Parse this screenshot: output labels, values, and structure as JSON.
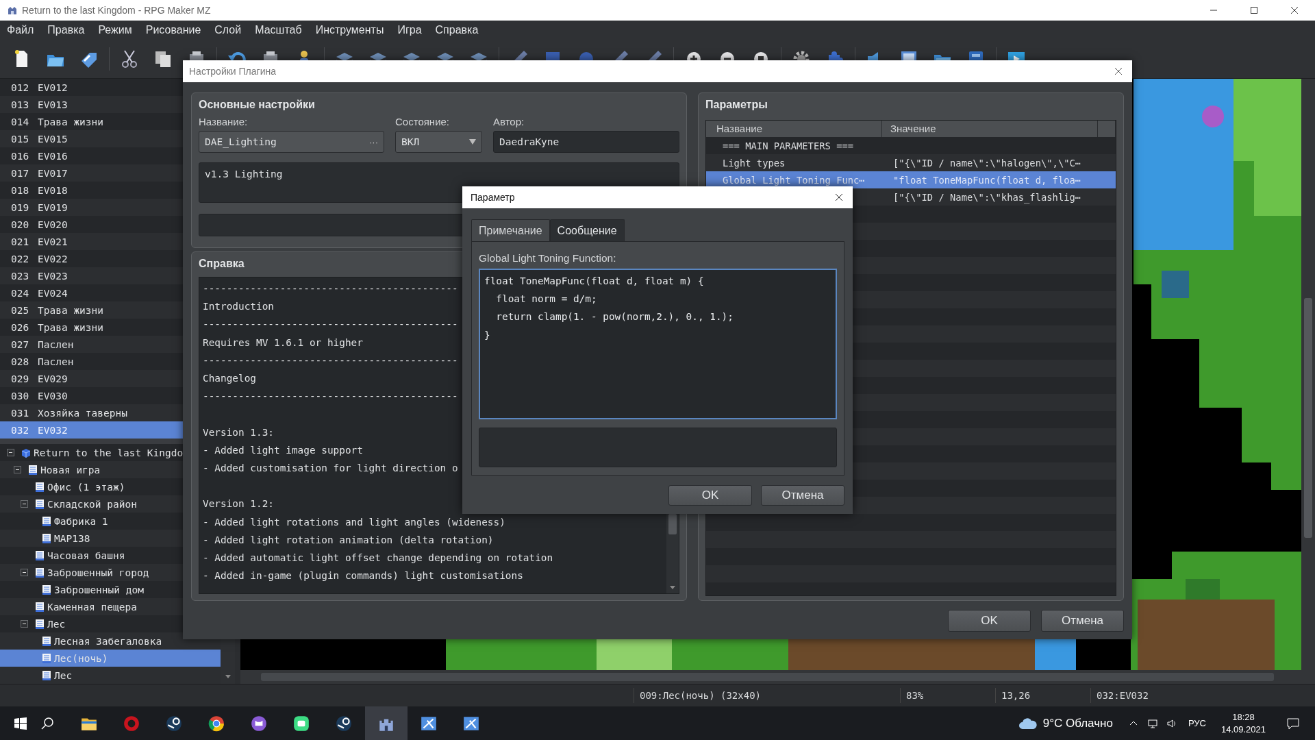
{
  "window": {
    "title": "Return to the last Kingdom - RPG Maker MZ"
  },
  "menu": [
    "Файл",
    "Правка",
    "Режим",
    "Рисование",
    "Слой",
    "Масштаб",
    "Инструменты",
    "Игра",
    "Справка"
  ],
  "events": [
    {
      "number": "012",
      "name": "EV012",
      "selected": false
    },
    {
      "number": "013",
      "name": "EV013",
      "selected": false
    },
    {
      "number": "014",
      "name": "Трава жизни",
      "selected": false
    },
    {
      "number": "015",
      "name": "EV015",
      "selected": false
    },
    {
      "number": "016",
      "name": "EV016",
      "selected": false
    },
    {
      "number": "017",
      "name": "EV017",
      "selected": false
    },
    {
      "number": "018",
      "name": "EV018",
      "selected": false
    },
    {
      "number": "019",
      "name": "EV019",
      "selected": false
    },
    {
      "number": "020",
      "name": "EV020",
      "selected": false
    },
    {
      "number": "021",
      "name": "EV021",
      "selected": false
    },
    {
      "number": "022",
      "name": "EV022",
      "selected": false
    },
    {
      "number": "023",
      "name": "EV023",
      "selected": false
    },
    {
      "number": "024",
      "name": "EV024",
      "selected": false
    },
    {
      "number": "025",
      "name": "Трава жизни",
      "selected": false
    },
    {
      "number": "026",
      "name": "Трава жизни",
      "selected": false
    },
    {
      "number": "027",
      "name": "Паслен",
      "selected": false
    },
    {
      "number": "028",
      "name": "Паслен",
      "selected": false
    },
    {
      "number": "029",
      "name": "EV029",
      "selected": false
    },
    {
      "number": "030",
      "name": "EV030",
      "selected": false
    },
    {
      "number": "031",
      "name": "Хозяйка таверны",
      "selected": false
    },
    {
      "number": "032",
      "name": "EV032",
      "selected": true
    }
  ],
  "map_tree": [
    {
      "label": "Return to the last Kingdo",
      "kind": "project",
      "expanded": true,
      "selected": false,
      "children": [
        {
          "label": "Новая игра",
          "kind": "map",
          "expanded": true,
          "selected": false,
          "children": [
            {
              "label": "Офис (1 этаж)",
              "kind": "map",
              "selected": false
            },
            {
              "label": "Складской район",
              "kind": "map",
              "expanded": true,
              "selected": false,
              "children": [
                {
                  "label": "Фабрика 1",
                  "kind": "map",
                  "selected": false
                },
                {
                  "label": "MAP138",
                  "kind": "map",
                  "selected": false
                }
              ]
            },
            {
              "label": "Часовая башня",
              "kind": "map",
              "selected": false
            },
            {
              "label": "Заброшенный город",
              "kind": "map",
              "expanded": true,
              "selected": false,
              "children": [
                {
                  "label": "Заброшенный дом",
                  "kind": "map",
                  "selected": false
                }
              ]
            },
            {
              "label": "Каменная пещера",
              "kind": "map",
              "selected": false
            },
            {
              "label": "Лес",
              "kind": "map",
              "expanded": true,
              "selected": false,
              "children": [
                {
                  "label": "Лесная Забегаловка",
                  "kind": "map",
                  "selected": false
                },
                {
                  "label": "Лес(ночь)",
                  "kind": "map",
                  "selected": true
                },
                {
                  "label": "Лес",
                  "kind": "map",
                  "selected": false
                }
              ]
            }
          ]
        }
      ]
    }
  ],
  "plugin_dialog": {
    "title": "Настройки Плагина",
    "general": {
      "heading": "Основные настройки",
      "name_label": "Название:",
      "name": "DAE_Lighting",
      "browse": "···",
      "state_label": "Состояние:",
      "state": "ВКЛ",
      "author_label": "Автор:",
      "author": "DaedraKyne",
      "description": "v1.3 Lighting"
    },
    "help": {
      "heading": "Справка",
      "sections": [
        [
          "-------------------------------------------",
          "Introduction",
          "-------------------------------------------",
          "Requires MV 1.6.1 or higher",
          "-------------------------------------------",
          "Changelog",
          "-------------------------------------------"
        ],
        [
          "Version 1.3:",
          "- Added light image support",
          "- Added customisation for light direction o"
        ],
        [
          "Version 1.2:",
          "- Added light rotations and light angles (wideness)",
          "- Added light rotation animation (delta rotation)",
          "- Added automatic light offset change depending on rotation",
          "- Added in-game (plugin commands) light customisations"
        ]
      ]
    },
    "parameters": {
      "heading": "Параметры",
      "columns": [
        "Название",
        "Значение"
      ],
      "rows": [
        {
          "name": "=== MAIN PARAMETERS ===",
          "selected": false
        },
        {
          "name": "Light types",
          "value": "[\"{\\\"ID / name\\\":\\\"halogen\\\",\\\"C⋯",
          "selected": false
        },
        {
          "name": "Global Light Toning Func⋯",
          "value": "\"float ToneMapFunc(float d, floa⋯",
          "selected": true
        },
        {
          "value": "[\"{\\\"ID / Name\\\":\\\"khas_flashlig⋯",
          "selected": false
        }
      ]
    },
    "buttons": [
      "OK",
      "Отмена"
    ]
  },
  "parameter_dialog": {
    "title": "Параметр",
    "tabs": [
      {
        "label": "Примечание",
        "selected": true
      },
      {
        "label": "Сообщение",
        "selected": false
      }
    ],
    "label": "Global Light Toning Function:",
    "value": "float ToneMapFunc(float d, float m) {\n  float norm = d/m;\n  return clamp(1. - pow(norm,2.), 0., 1.);\n}",
    "buttons": [
      "OK",
      "Отмена"
    ]
  },
  "status_bar": [
    "009:Лес(ночь) (32x40)",
    "83%",
    "13,26",
    "032:EV032"
  ],
  "taskbar": {
    "apps": [
      {
        "kind": "folder",
        "active": false
      },
      {
        "kind": "badge",
        "active": false
      },
      {
        "kind": "ring",
        "active": false
      },
      {
        "kind": "globe",
        "active": false
      },
      {
        "kind": "cat",
        "active": false
      },
      {
        "kind": "chat",
        "active": false
      },
      {
        "kind": "ring",
        "active": false
      },
      {
        "kind": "castle",
        "active": true
      },
      {
        "kind": "window",
        "active": false
      },
      {
        "kind": "window",
        "active": false
      }
    ],
    "weather": "9°C Облачно",
    "language": "РУС",
    "time": "18:28",
    "date": "14.09.2021"
  }
}
